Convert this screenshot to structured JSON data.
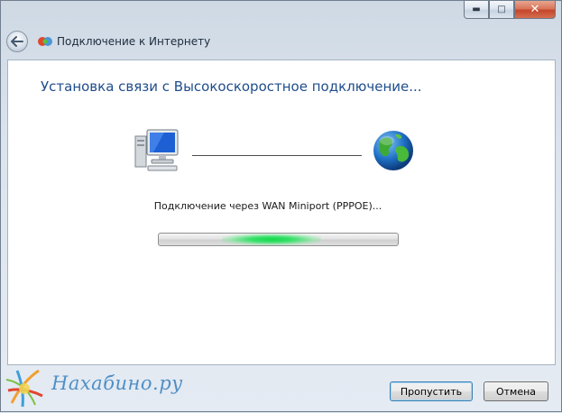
{
  "window": {
    "title": "Подключение к Интернету",
    "caption_buttons": {
      "minimize": "▬",
      "maximize": "□",
      "close": "✕"
    }
  },
  "main": {
    "heading": "Установка связи с Высокоскоростное подключение...",
    "status": "Подключение через WAN Miniport (PPPOE)...",
    "progress_mode": "indeterminate"
  },
  "footer": {
    "watermark_text": "Нахабино.ру",
    "skip_label": "Пропустить",
    "cancel_label": "Отмена"
  },
  "colors": {
    "heading": "#1f4d8c",
    "progress_glow": "#13d94a",
    "close_button": "#c4452a"
  },
  "icons": [
    "back-arrow-icon",
    "network-connection-icon",
    "computer-icon",
    "globe-icon"
  ]
}
